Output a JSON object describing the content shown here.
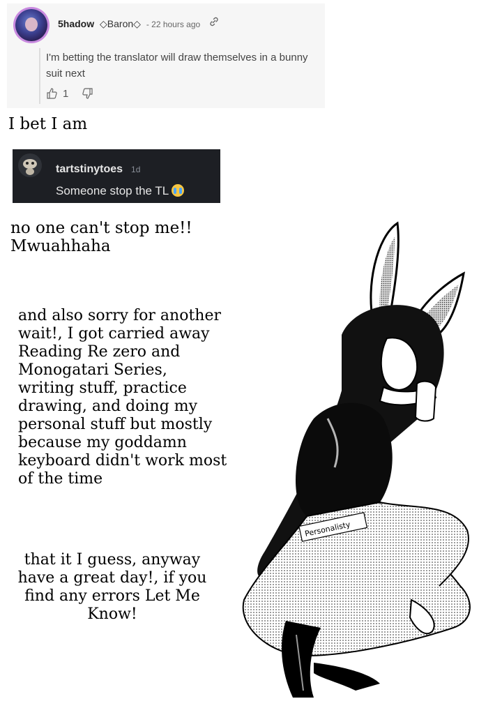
{
  "comment_light": {
    "username": "5hadow",
    "badge": "◇Baron◇",
    "time": "- 22 hours ago",
    "body": "I'm betting the translator will draw themselves in a bunny suit next",
    "like_count": "1"
  },
  "caption_1": "I bet I am",
  "comment_dark": {
    "username": "tartstinytoes",
    "time": "1d",
    "body": "Someone stop the TL"
  },
  "caption_2": "no one can't stop me!! Mwuahhaha",
  "caption_3": "and also sorry for another wait!, I got carried away Reading Re zero and Monogatari Series, writing stuff, practice drawing, and doing my personal stuff but mostly because my goddamn keyboard didn't work most of the time",
  "caption_4": "that it I guess, anyway have a great day!, if you find any errors  Let Me Know!",
  "illustration": {
    "signature": "Personalisty"
  }
}
